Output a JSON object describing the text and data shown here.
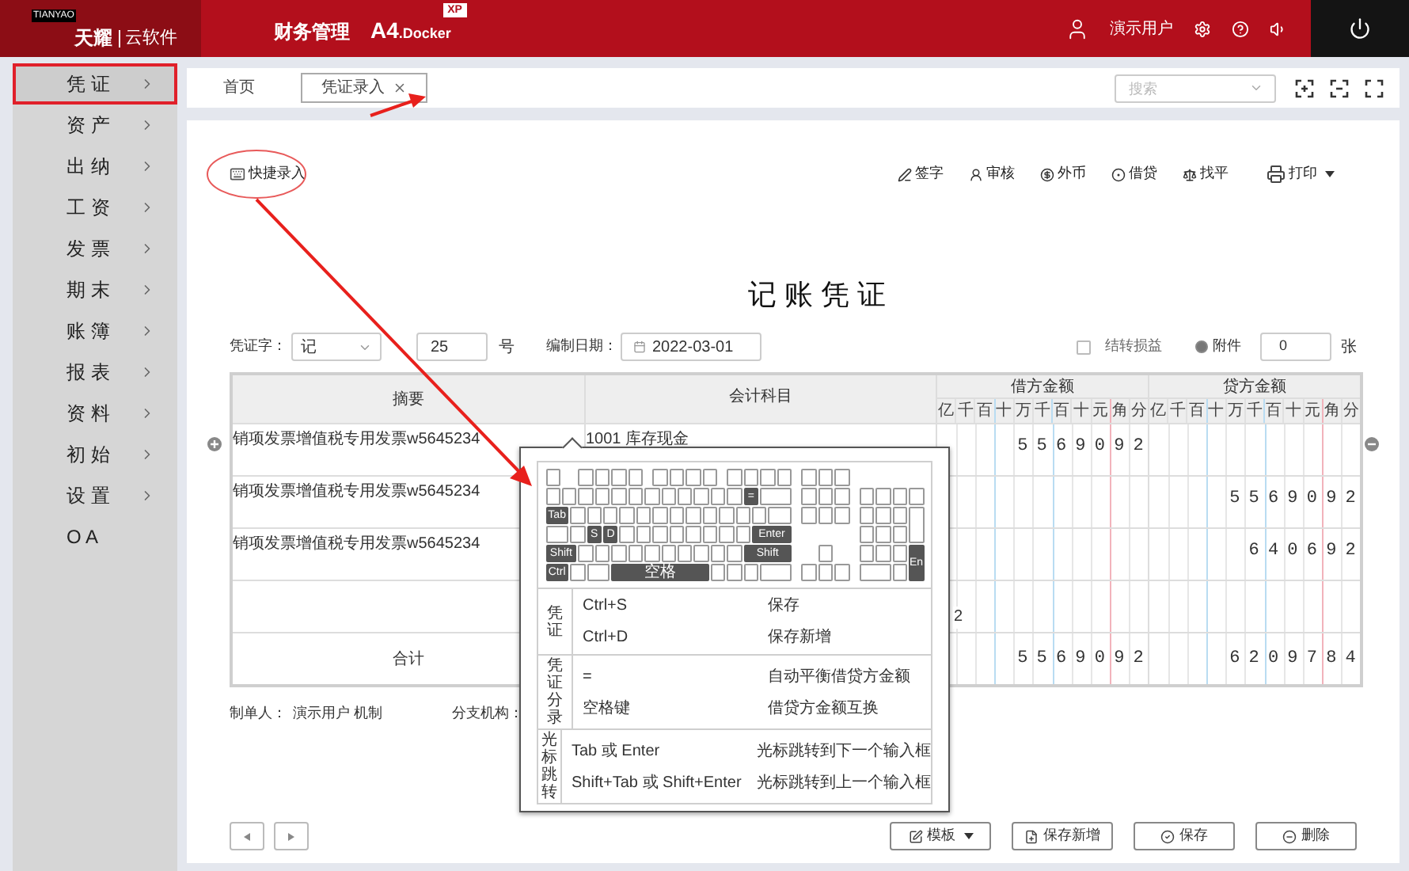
{
  "header": {
    "logo_tag": "TIANYAO",
    "brand": "天耀",
    "brand_sub": "云软件",
    "product": "财务管理",
    "edition_main": "A4",
    "edition_suffix": ".Docker",
    "edition_badge": "XP",
    "user": "演示用户"
  },
  "sidebar": {
    "items": [
      {
        "label": "凭 证",
        "selected": true,
        "arrow": true
      },
      {
        "label": "资 产",
        "selected": false,
        "arrow": true
      },
      {
        "label": "出 纳",
        "selected": false,
        "arrow": true
      },
      {
        "label": "工 资",
        "selected": false,
        "arrow": true
      },
      {
        "label": "发 票",
        "selected": false,
        "arrow": true
      },
      {
        "label": "期 末",
        "selected": false,
        "arrow": true
      },
      {
        "label": "账 簿",
        "selected": false,
        "arrow": true
      },
      {
        "label": "报 表",
        "selected": false,
        "arrow": true
      },
      {
        "label": "资 料",
        "selected": false,
        "arrow": true
      },
      {
        "label": "初 始",
        "selected": false,
        "arrow": true
      },
      {
        "label": "设 置",
        "selected": false,
        "arrow": true
      },
      {
        "label": "O A",
        "selected": false,
        "arrow": false
      }
    ]
  },
  "tabs": [
    {
      "label": "首页",
      "selected": false,
      "closable": false
    },
    {
      "label": "凭证录入",
      "selected": true,
      "closable": true
    }
  ],
  "search": {
    "placeholder": "搜索"
  },
  "toolbar": {
    "quick_entry": "快捷录入",
    "actions": [
      {
        "label": "签字",
        "kind": "sign"
      },
      {
        "label": "审核",
        "kind": "audit"
      },
      {
        "label": "外币",
        "kind": "currency"
      },
      {
        "label": "借贷",
        "kind": "swap"
      },
      {
        "label": "找平",
        "kind": "balance"
      },
      {
        "label": "打印",
        "kind": "print"
      }
    ]
  },
  "voucher": {
    "title": "记 账 凭 证",
    "word_label": "凭证字：",
    "word": "记",
    "number": "25",
    "number_suffix": "号",
    "date_label": "编制日期：",
    "date": "2022-03-01",
    "carry_over": {
      "label": "结转损益",
      "checked": false
    },
    "attachment": {
      "label": "附件",
      "checked": true
    },
    "attachment_count": "0",
    "attachment_suffix": "张"
  },
  "table": {
    "columns": [
      "摘要",
      "会计科目",
      "借方金额",
      "贷方金额"
    ],
    "debit_units": [
      "亿",
      "千",
      "百",
      "十",
      "万",
      "千",
      "百",
      "十",
      "元",
      "角",
      "分"
    ],
    "credit_units": [
      "亿",
      "千",
      "百",
      "十",
      "万",
      "千",
      "百",
      "十",
      "元",
      "角",
      "分"
    ],
    "rows": [
      {
        "summary": "销项发票增值税专用发票w5645234",
        "account": "1001 库存现金",
        "overflow_text": "",
        "debit": "5569092",
        "credit": ""
      },
      {
        "summary": "销项发票增值税专用发票w5645234",
        "account": "",
        "overflow_text": "",
        "debit": "",
        "credit": "5569092"
      },
      {
        "summary": "销项发票增值税专用发票w5645234",
        "account": "",
        "overflow_text": "",
        "debit": "",
        "credit": "640692"
      },
      {
        "summary": "",
        "account": "",
        "overflow_text": "2",
        "debit": "",
        "credit": ""
      }
    ],
    "total": {
      "label": "合计",
      "debit": "5569092",
      "credit": "6209784"
    }
  },
  "footer": {
    "maker_label": "制单人：",
    "maker": "演示用户 机制",
    "branch_label": "分支机构："
  },
  "shortcuts": {
    "keyboard_keys": [
      "=",
      "Tab",
      "S",
      "D",
      "Enter",
      "Shift",
      "Shift",
      "Ctrl",
      "空格",
      "En"
    ],
    "sections": [
      {
        "title": "凭证",
        "items": [
          {
            "keys": "Ctrl+S",
            "action": "保存"
          },
          {
            "keys": "Ctrl+D",
            "action": "保存新增"
          }
        ]
      },
      {
        "title": "凭证分录",
        "items": [
          {
            "keys": "=",
            "action": "自动平衡借贷方金额"
          },
          {
            "keys": "空格键",
            "action": "借贷方金额互换"
          }
        ]
      },
      {
        "title": "光标跳转",
        "items": [
          {
            "keys": "Tab 或 Enter",
            "action": "光标跳转到下一个输入框"
          },
          {
            "keys": "Shift+Tab 或 Shift+Enter",
            "action": "光标跳转到上一个输入框"
          }
        ]
      }
    ]
  },
  "buttons": [
    {
      "label": "模板",
      "kind": "template"
    },
    {
      "label": "保存新增",
      "kind": "save_new"
    },
    {
      "label": "保存",
      "kind": "save"
    },
    {
      "label": "删除",
      "kind": "delete"
    }
  ]
}
